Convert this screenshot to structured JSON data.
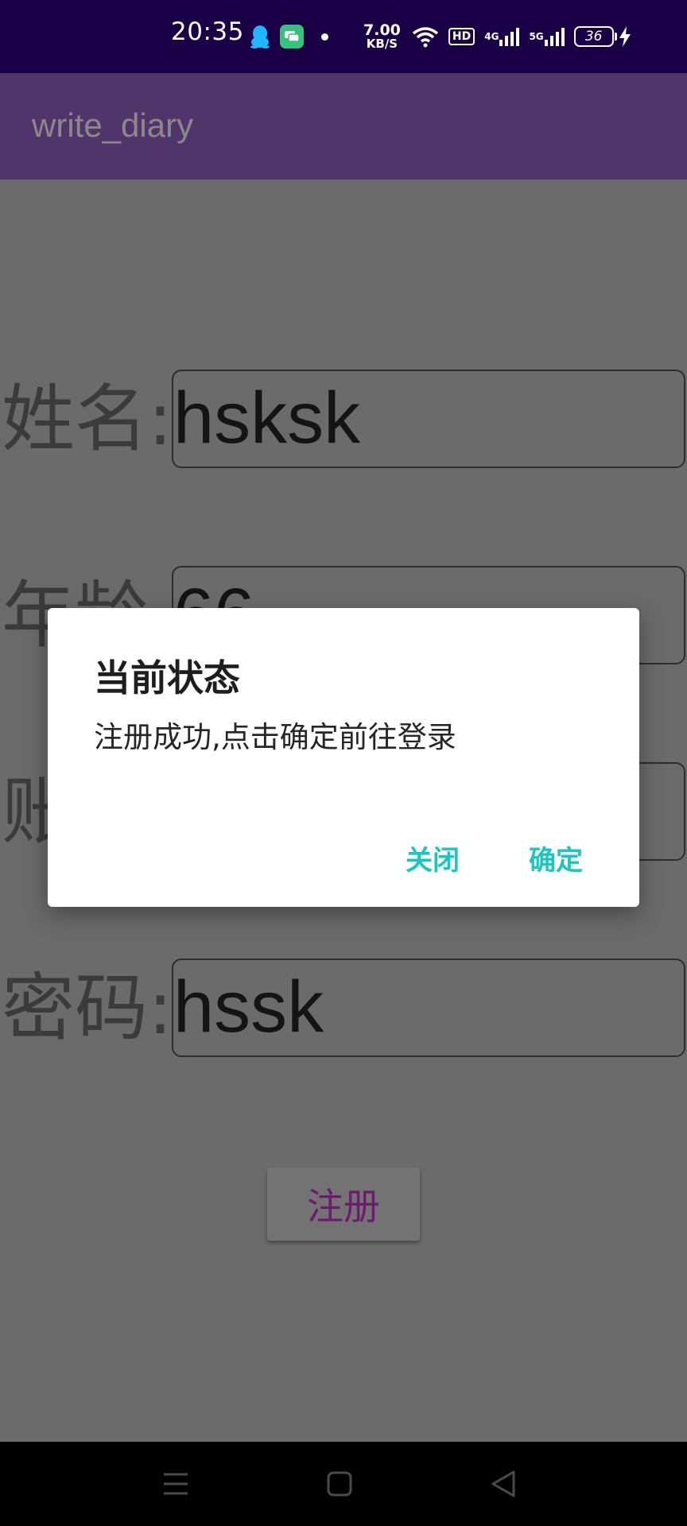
{
  "status_bar": {
    "time": "20:35",
    "speed_value": "7.00",
    "speed_unit": "KB/S",
    "hd_label": "HD",
    "signal_1_label": "4G",
    "signal_2_label": "5G",
    "battery_level": "36",
    "icons": [
      "qq-icon",
      "message-icon",
      "dot-icon",
      "wifi-icon",
      "hd-icon",
      "signal-4g-icon",
      "signal-5g-icon",
      "battery-icon",
      "charging-icon"
    ]
  },
  "app_bar": {
    "title": "write_diary"
  },
  "form": {
    "name": {
      "label": "姓名:",
      "value": "hsksk"
    },
    "age": {
      "label": "年龄",
      "value": "66"
    },
    "account": {
      "label": "账",
      "value": ""
    },
    "password": {
      "label": "密码:",
      "value": "hssk"
    },
    "register_label": "注册"
  },
  "dialog": {
    "title": "当前状态",
    "message": "注册成功,点击确定前往登录",
    "close_label": "关闭",
    "confirm_label": "确定"
  },
  "nav_bar": {
    "icons": [
      "menu-icon",
      "home-icon",
      "back-icon"
    ]
  },
  "colors": {
    "status_bar_bg": "#1a0046",
    "app_bar_bg": "#51356a",
    "dialog_button": "#1ac6c0",
    "register_text": "#6e1a6e"
  }
}
